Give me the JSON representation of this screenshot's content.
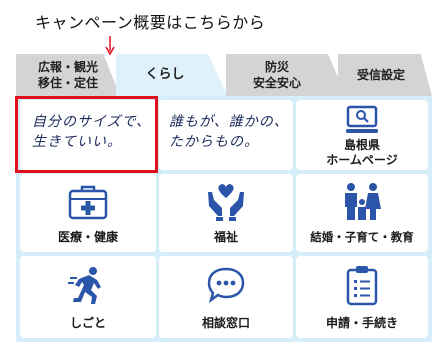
{
  "annotation": {
    "text": "キャンペーン概要はこちらから"
  },
  "tabs": [
    {
      "label": "広報・観光\n移住・定住",
      "active": false
    },
    {
      "label": "くらし",
      "active": true
    },
    {
      "label": "防災\n安全安心",
      "active": false
    },
    {
      "label": "受信設定",
      "active": false
    }
  ],
  "banners": [
    {
      "text": "自分のサイズで、\n生きていい。"
    },
    {
      "text": "誰もが、誰かの、\nたからもの。"
    }
  ],
  "tiles": [
    {
      "label": "島根県\nホームページ",
      "icon": "computer-search-icon"
    },
    {
      "label": "医療・健康",
      "icon": "medical-kit-icon"
    },
    {
      "label": "福祉",
      "icon": "hands-heart-icon"
    },
    {
      "label": "結婚・子育て・教育",
      "icon": "family-icon"
    },
    {
      "label": "しごと",
      "icon": "running-person-icon"
    },
    {
      "label": "相談窓口",
      "icon": "chat-bubble-icon"
    },
    {
      "label": "申請・手続き",
      "icon": "clipboard-list-icon"
    }
  ],
  "colors": {
    "accent": "#2a55a8",
    "panel": "#d6eefa",
    "tab_inactive": "#d4d4d4",
    "highlight": "#e0101e"
  }
}
